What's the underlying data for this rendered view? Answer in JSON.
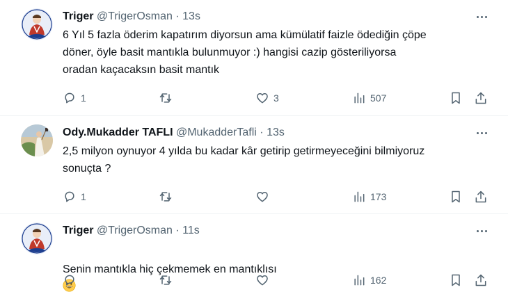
{
  "tweets": [
    {
      "name": "Triger",
      "handle": "@TrigerOsman",
      "separator": "·",
      "time": "13s",
      "text": "6 Yıl 5 fazla öderim kapatırım diyorsun ama kümülatif faizle ödediğin çöpe\ndöner, öyle basit mantıkla bulunmuyor :) hangisi cazip gösteriliyorsa\noradan kaçacaksın basit mantık",
      "replies": "1",
      "retweets": "",
      "likes": "3",
      "views": "507",
      "avatar_colors": {
        "bg": "#e9eef8",
        "figure": "#c0392b",
        "accent": "#1d3e8f"
      }
    },
    {
      "name": "Ody.Mukadder TAFLI",
      "handle": "@MukadderTafli",
      "separator": "·",
      "time": "13s",
      "text": "2,5 milyon oynuyor 4 yılda bu kadar kâr getirip getirmeyeceğini bilmiyoruz\nsonuçta ?",
      "replies": "1",
      "retweets": "",
      "likes": "",
      "views": "173",
      "avatar_colors": {
        "bg": "#d9c8a6",
        "figure": "#f4f1ea",
        "accent": "#6b8e4e"
      }
    },
    {
      "name": "Triger",
      "handle": "@TrigerOsman",
      "separator": "·",
      "time": "11s",
      "text": "Senin mantıkla hiç çekmemek en mantıklısı",
      "emoji": "grinning-face",
      "replies": "",
      "retweets": "",
      "likes": "",
      "views": "162",
      "avatar_colors": {
        "bg": "#e9eef8",
        "figure": "#c0392b",
        "accent": "#1d3e8f"
      }
    }
  ],
  "icons": {
    "reply": "reply-icon",
    "retweet": "retweet-icon",
    "like": "heart-icon",
    "views": "views-chart-icon",
    "bookmark": "bookmark-icon",
    "share": "share-icon",
    "more": "more-dots-icon"
  },
  "colors": {
    "text": "#0f1419",
    "secondary": "#536471",
    "divider": "#eff3f4",
    "background": "#ffffff"
  }
}
